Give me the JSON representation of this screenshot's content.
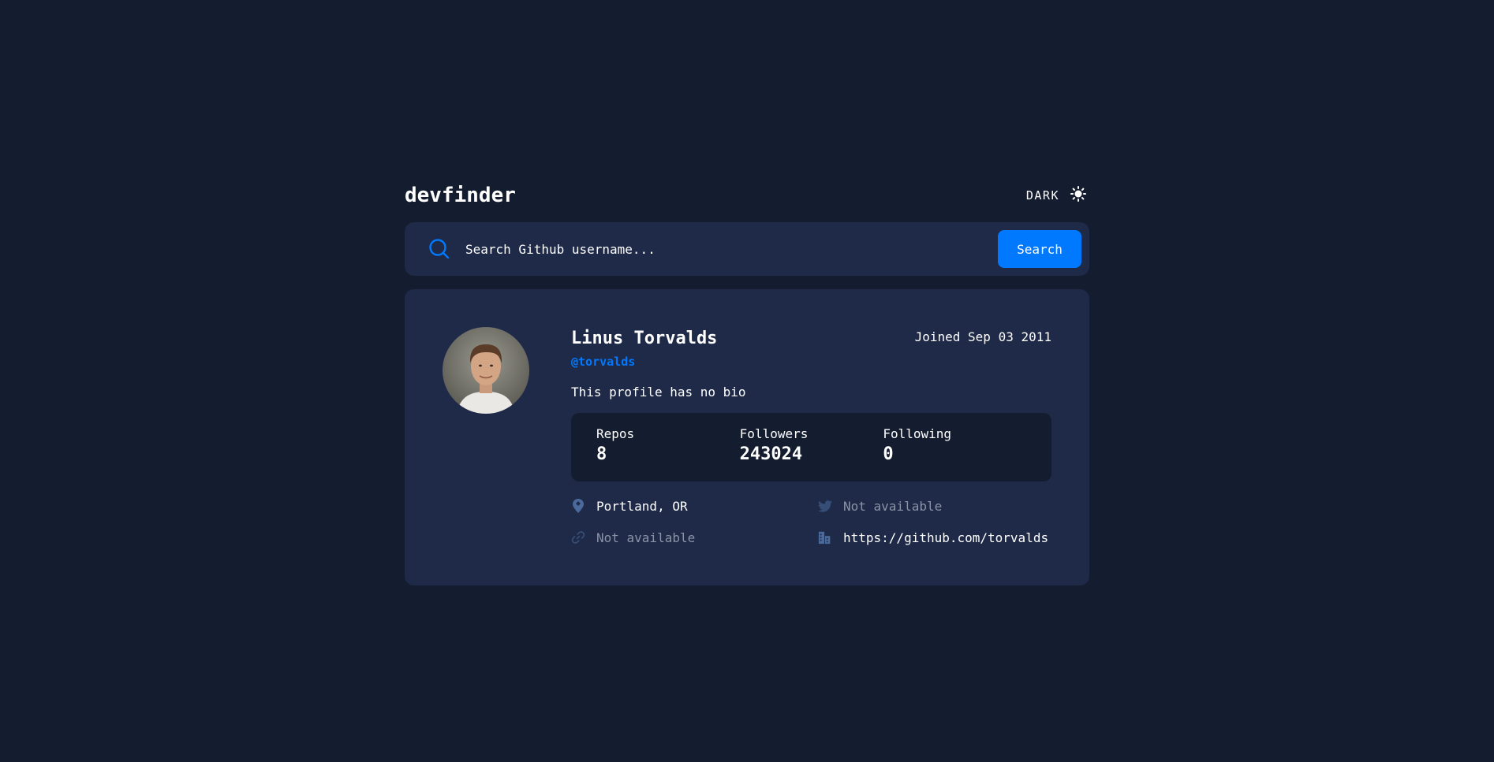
{
  "app": {
    "logo": "devfinder",
    "theme_label": "DARK"
  },
  "search": {
    "placeholder": "Search Github username...",
    "button_label": "Search"
  },
  "profile": {
    "name": "Linus Torvalds",
    "login": "@torvalds",
    "joined": "Joined Sep 03 2011",
    "bio": "This profile has no bio",
    "stats": [
      {
        "label": "Repos",
        "value": "8"
      },
      {
        "label": "Followers",
        "value": "243024"
      },
      {
        "label": "Following",
        "value": "0"
      }
    ],
    "location": "Portland, OR",
    "twitter": "Not available",
    "blog": "Not available",
    "company": "https://github.com/torvalds"
  },
  "colors": {
    "background": "#141d2f",
    "card": "#1e2a47",
    "accent": "#0079ff",
    "text": "#ffffff"
  },
  "icons": {
    "theme": "sun-icon",
    "search": "search-icon",
    "location": "location-pin-icon",
    "twitter": "twitter-icon",
    "blog": "link-icon",
    "company": "company-building-icon"
  }
}
